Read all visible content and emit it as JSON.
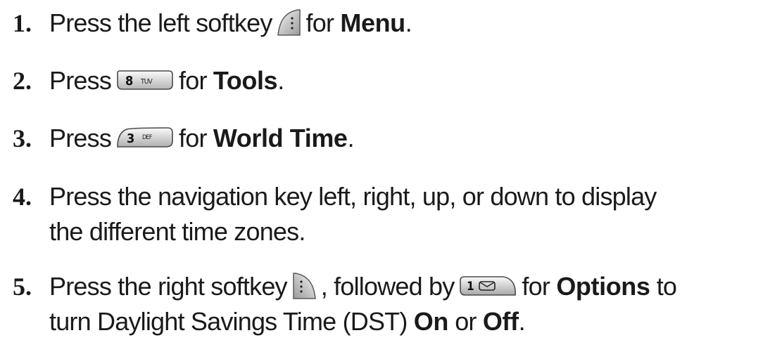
{
  "steps": [
    {
      "number": "1.",
      "before": "Press the left softkey",
      "key_icon": "left-softkey-icon",
      "after": "for",
      "bold": "Menu",
      "end": "."
    },
    {
      "number": "2.",
      "before": "Press",
      "key_icon": "key-8-tuv-icon",
      "key_digit": "8",
      "key_letters": "TUV",
      "after": "for",
      "bold": "Tools",
      "end": "."
    },
    {
      "number": "3.",
      "before": "Press",
      "key_icon": "key-3-def-icon",
      "key_digit": "3",
      "key_letters": "DEF",
      "after": "for",
      "bold": "World Time",
      "end": "."
    },
    {
      "number": "4.",
      "line1": "Press the navigation key left, right, up, or down to display",
      "line2": "the different time zones."
    },
    {
      "number": "5.",
      "before": "Press the right softkey",
      "key_icon": "right-softkey-icon",
      "middle": ", followed by",
      "key2_icon": "key-1-voicemail-icon",
      "key2_digit": "1",
      "after": "for",
      "bold": "Options",
      "after2": "to",
      "line2_before": "turn Daylight Savings Time (DST)",
      "bold2": "On",
      "or": "or",
      "bold3": "Off",
      "end": "."
    }
  ]
}
